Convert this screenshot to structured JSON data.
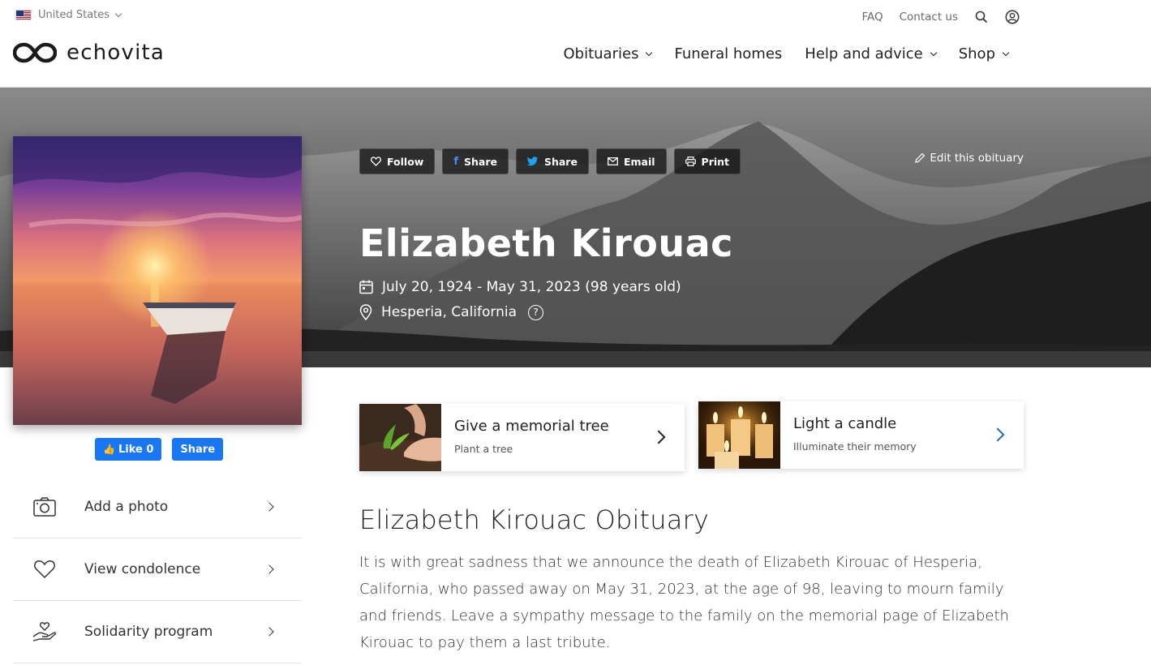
{
  "topbar": {
    "country": "United States",
    "faq": "FAQ",
    "contact": "Contact us"
  },
  "header": {
    "logo_text": "echovita",
    "nav": [
      {
        "label": "Obituaries"
      },
      {
        "label": "Funeral homes"
      },
      {
        "label": "Help and advice"
      },
      {
        "label": "Shop"
      }
    ]
  },
  "hero": {
    "actions": {
      "follow": "Follow",
      "share_fb": "Share",
      "share_tw": "Share",
      "email": "Email",
      "print": "Print"
    },
    "edit_link": "Edit this obituary",
    "name": "Elizabeth Kirouac",
    "dates": "July 20, 1924 - May 31, 2023 (98 years old)",
    "location": "Hesperia, California",
    "help_mark": "?"
  },
  "social": {
    "like": "Like 0",
    "share": "Share"
  },
  "sidebar": {
    "items": [
      {
        "label": "Add a photo",
        "icon": "camera-icon"
      },
      {
        "label": "View condolence",
        "icon": "heart-icon"
      },
      {
        "label": "Solidarity program",
        "icon": "hand-heart-icon"
      }
    ]
  },
  "cards": {
    "tree": {
      "title": "Give a memorial tree",
      "subtitle": "Plant a tree"
    },
    "candle": {
      "title": "Light a candle",
      "subtitle": "Illuminate their memory"
    }
  },
  "obituary": {
    "title": "Elizabeth Kirouac Obituary",
    "body": "It is with great sadness that we announce the death of Elizabeth Kirouac of Hesperia, California, who passed away on May 31, 2023, at the age of 98, leaving to mourn family and friends. Leave a sympathy message to the family on the memorial page of Elizabeth Kirouac to pay them a last tribute."
  },
  "colors": {
    "facebook": "#1877f2",
    "candle_arrow": "#1d6fb0",
    "action_bg": "#141414"
  }
}
